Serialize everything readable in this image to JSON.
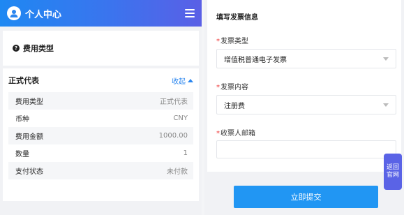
{
  "header": {
    "title": "个人中心"
  },
  "fee_type_card": {
    "title": "费用类型"
  },
  "detail": {
    "title": "正式代表",
    "collapse_label": "收起",
    "rows": [
      {
        "label": "费用类型",
        "value": "正式代表"
      },
      {
        "label": "币种",
        "value": "CNY"
      },
      {
        "label": "费用金额",
        "value": "1000.00"
      },
      {
        "label": "数量",
        "value": "1"
      },
      {
        "label": "支付状态",
        "value": "未付款"
      }
    ]
  },
  "invoice_form": {
    "title": "填写发票信息",
    "invoice_type": {
      "label": "发票类型",
      "value": "增值税普通电子发票"
    },
    "invoice_content": {
      "label": "发票内容",
      "value": "注册费"
    },
    "recipient_email": {
      "label": "收票人邮箱",
      "value": ""
    },
    "required_mark": "*"
  },
  "submit_label": "立即提交",
  "float_button_label": "返回官网"
}
